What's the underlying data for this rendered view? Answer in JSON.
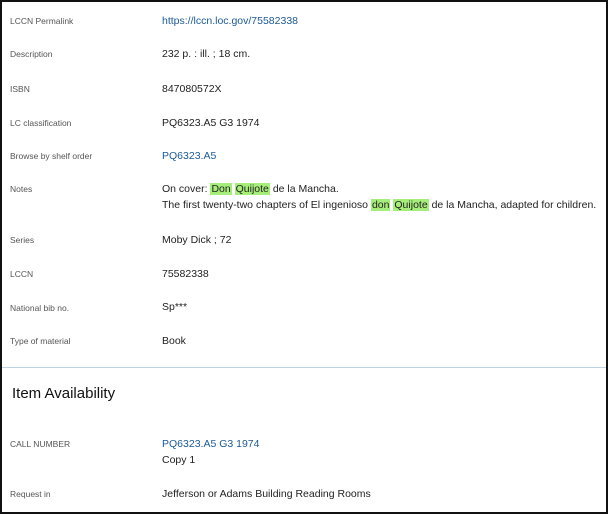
{
  "record": {
    "permalink": {
      "label": "LCCN Permalink",
      "value": "https://lccn.loc.gov/75582338"
    },
    "description": {
      "label": "Description",
      "value": "232 p. : ill. ; 18 cm."
    },
    "isbn": {
      "label": "ISBN",
      "value": "847080572X"
    },
    "lc_classification": {
      "label": "LC classification",
      "value": "PQ6323.A5 G3 1974"
    },
    "shelf_order": {
      "label": "Browse by shelf order",
      "value": "PQ6323.A5"
    },
    "notes": {
      "label": "Notes",
      "line1": {
        "before": "On cover: ",
        "hl1": "Don",
        "space": " ",
        "hl2": "Quijote",
        "after": " de la Mancha."
      },
      "line2": {
        "before": "The first twenty-two chapters of El ingenioso ",
        "hl1": "don",
        "space": " ",
        "hl2": "Quijote",
        "after": " de la Mancha, adapted for children."
      }
    },
    "series": {
      "label": "Series",
      "value": "Moby Dick ; 72"
    },
    "lccn": {
      "label": "LCCN",
      "value": "75582338"
    },
    "national_bib": {
      "label": "National bib no.",
      "value": "Sp***"
    },
    "material_type": {
      "label": "Type of material",
      "value": "Book"
    }
  },
  "availability": {
    "title": "Item Availability",
    "call_number": {
      "label": "CALL NUMBER",
      "value": "PQ6323.A5 G3 1974",
      "copy": "Copy 1"
    },
    "request_in": {
      "label": "Request in",
      "value": "Jefferson or Adams Building Reading Rooms"
    }
  },
  "colors": {
    "link": "#1b5a96",
    "highlight": "#a6ee7a",
    "divider": "#bcd3e6"
  }
}
